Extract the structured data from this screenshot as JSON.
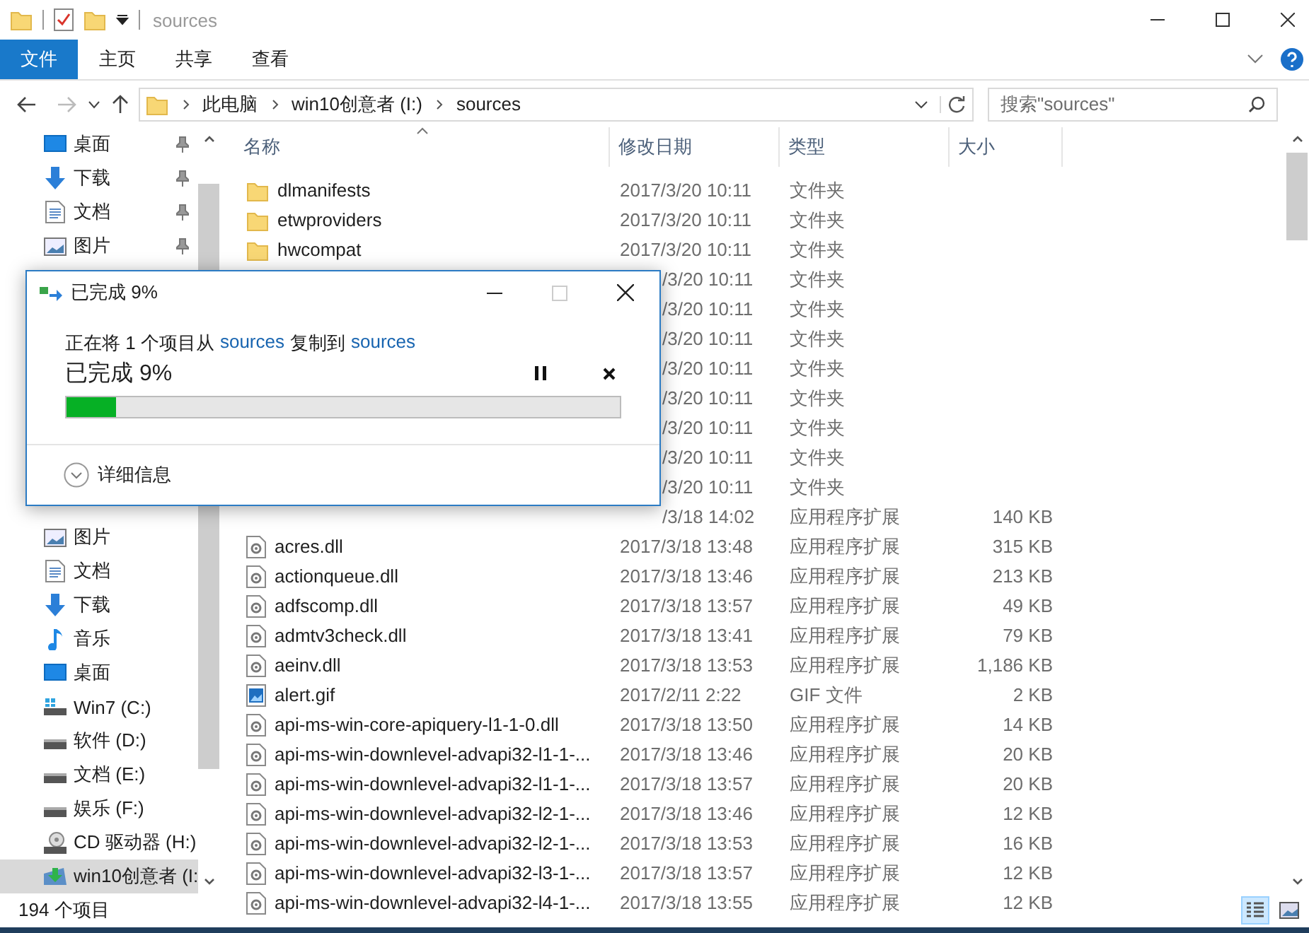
{
  "window": {
    "title": "sources"
  },
  "ribbon": {
    "tabs": [
      {
        "label": "文件",
        "kind": "file",
        "selected": false
      },
      {
        "label": "主页",
        "kind": "tab",
        "selected": false
      },
      {
        "label": "共享",
        "kind": "tab",
        "selected": false
      },
      {
        "label": "查看",
        "kind": "tab",
        "selected": false
      }
    ]
  },
  "address_bar": {
    "breadcrumbs": [
      "此电脑",
      "win10创意者 (I:)",
      "sources"
    ]
  },
  "search": {
    "placeholder": "搜索\"sources\""
  },
  "sidebar": {
    "groups": [
      {
        "items": [
          {
            "label": "桌面",
            "kind": "desktop",
            "pinned": true,
            "selected": false
          },
          {
            "label": "下载",
            "kind": "download",
            "pinned": true,
            "selected": false
          },
          {
            "label": "文档",
            "kind": "document",
            "pinned": true,
            "selected": false
          },
          {
            "label": "图片",
            "kind": "picture",
            "pinned": true,
            "selected": false
          }
        ]
      },
      {
        "items": [
          {
            "label": "图片",
            "kind": "picture",
            "pinned": false,
            "selected": false
          },
          {
            "label": "文档",
            "kind": "document",
            "pinned": false,
            "selected": false
          },
          {
            "label": "下载",
            "kind": "download",
            "pinned": false,
            "selected": false
          },
          {
            "label": "音乐",
            "kind": "music",
            "pinned": false,
            "selected": false
          },
          {
            "label": "桌面",
            "kind": "desktop",
            "pinned": false,
            "selected": false
          },
          {
            "label": "Win7 (C:)",
            "kind": "system-drive",
            "pinned": false,
            "selected": false
          },
          {
            "label": "软件 (D:)",
            "kind": "drive",
            "pinned": false,
            "selected": false
          },
          {
            "label": "文档 (E:)",
            "kind": "drive",
            "pinned": false,
            "selected": false
          },
          {
            "label": "娱乐 (F:)",
            "kind": "drive",
            "pinned": false,
            "selected": false
          },
          {
            "label": "CD 驱动器 (H:)",
            "kind": "cd",
            "pinned": false,
            "selected": false
          },
          {
            "label": "win10创意者 (I:",
            "kind": "setup-drive",
            "pinned": false,
            "selected": true
          }
        ]
      }
    ]
  },
  "file_list": {
    "columns": [
      {
        "label": "名称",
        "sorted": true
      },
      {
        "label": "修改日期",
        "sorted": false
      },
      {
        "label": "类型",
        "sorted": false
      },
      {
        "label": "大小",
        "sorted": false
      }
    ],
    "rows": [
      {
        "kind": "folder",
        "name": "dlmanifests",
        "date": "2017/3/20 10:11",
        "type": "文件夹"
      },
      {
        "kind": "folder",
        "name": "etwproviders",
        "date": "2017/3/20 10:11",
        "type": "文件夹"
      },
      {
        "kind": "folder",
        "name": "hwcompat",
        "date": "2017/3/20 10:11",
        "type": "文件夹"
      },
      {
        "date": "/3/20 10:11",
        "type": "文件夹"
      },
      {
        "date": "/3/20 10:11",
        "type": "文件夹"
      },
      {
        "date": "/3/20 10:11",
        "type": "文件夹"
      },
      {
        "date": "/3/20 10:11",
        "type": "文件夹"
      },
      {
        "date": "/3/20 10:11",
        "type": "文件夹"
      },
      {
        "date": "/3/20 10:11",
        "type": "文件夹"
      },
      {
        "date": "/3/20 10:11",
        "type": "文件夹"
      },
      {
        "date": "/3/20 10:11",
        "type": "文件夹"
      },
      {
        "date": "/3/18 14:02",
        "type": "应用程序扩展",
        "size": "140 KB"
      },
      {
        "kind": "dll",
        "name": "acres.dll",
        "date": "2017/3/18 13:48",
        "type": "应用程序扩展",
        "size": "315 KB"
      },
      {
        "kind": "dll",
        "name": "actionqueue.dll",
        "date": "2017/3/18 13:46",
        "type": "应用程序扩展",
        "size": "213 KB"
      },
      {
        "kind": "dll",
        "name": "adfscomp.dll",
        "date": "2017/3/18 13:57",
        "type": "应用程序扩展",
        "size": "49 KB"
      },
      {
        "kind": "dll",
        "name": "admtv3check.dll",
        "date": "2017/3/18 13:41",
        "type": "应用程序扩展",
        "size": "79 KB"
      },
      {
        "kind": "dll",
        "name": "aeinv.dll",
        "date": "2017/3/18 13:53",
        "type": "应用程序扩展",
        "size": "1,186 KB"
      },
      {
        "kind": "image",
        "name": "alert.gif",
        "date": "2017/2/11 2:22",
        "type": "GIF 文件",
        "size": "2 KB"
      },
      {
        "kind": "dll",
        "name": "api-ms-win-core-apiquery-l1-1-0.dll",
        "date": "2017/3/18 13:50",
        "type": "应用程序扩展",
        "size": "14 KB"
      },
      {
        "kind": "dll",
        "name": "api-ms-win-downlevel-advapi32-l1-1-...",
        "date": "2017/3/18 13:46",
        "type": "应用程序扩展",
        "size": "20 KB"
      },
      {
        "kind": "dll",
        "name": "api-ms-win-downlevel-advapi32-l1-1-...",
        "date": "2017/3/18 13:57",
        "type": "应用程序扩展",
        "size": "20 KB"
      },
      {
        "kind": "dll",
        "name": "api-ms-win-downlevel-advapi32-l2-1-...",
        "date": "2017/3/18 13:46",
        "type": "应用程序扩展",
        "size": "12 KB"
      },
      {
        "kind": "dll",
        "name": "api-ms-win-downlevel-advapi32-l2-1-...",
        "date": "2017/3/18 13:53",
        "type": "应用程序扩展",
        "size": "16 KB"
      },
      {
        "kind": "dll",
        "name": "api-ms-win-downlevel-advapi32-l3-1-...",
        "date": "2017/3/18 13:57",
        "type": "应用程序扩展",
        "size": "12 KB"
      },
      {
        "kind": "dll",
        "name": "api-ms-win-downlevel-advapi32-l4-1-...",
        "date": "2017/3/18 13:55",
        "type": "应用程序扩展",
        "size": "12 KB"
      }
    ]
  },
  "status_bar": {
    "item_count": "194 个项目",
    "view_buttons": [
      {
        "kind": "details",
        "selected": true
      },
      {
        "kind": "large-icons",
        "selected": false
      }
    ]
  },
  "copy_dialog": {
    "title": "已完成 9%",
    "maximize_disabled": true,
    "message": [
      {
        "kind": "text",
        "text": "正在将 1 个项目从"
      },
      {
        "kind": "link",
        "text": "sources"
      },
      {
        "kind": "text",
        "text": "复制到"
      },
      {
        "kind": "link",
        "text": "sources"
      }
    ],
    "progress_text": "已完成 9%",
    "level": 0.09,
    "details_label": "详细信息"
  }
}
